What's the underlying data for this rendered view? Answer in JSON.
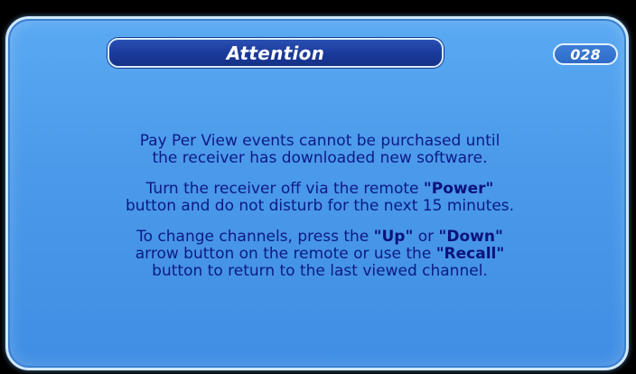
{
  "dialog": {
    "title": "Attention",
    "code": "028",
    "paragraph1": {
      "line1": "Pay Per View events cannot be purchased until",
      "line2": "the receiver has downloaded new software."
    },
    "paragraph2": {
      "line1_pre": "Turn the receiver off via the remote ",
      "line1_kw": "\"Power\"",
      "line2": "button and do not disturb for the next 15 minutes."
    },
    "paragraph3": {
      "line1_pre": "To change channels, press the ",
      "line1_kw1": "\"Up\"",
      "line1_mid": " or ",
      "line1_kw2": "\"Down\"",
      "line2_pre": "arrow button on the remote or use the ",
      "line2_kw": "\"Recall\"",
      "line3": "button to return to the last viewed channel."
    }
  },
  "colors": {
    "panel": "#4a99ea",
    "title_bar": "#1a3a9a",
    "text": "#0c1a86",
    "border": "#cfe8ff"
  }
}
